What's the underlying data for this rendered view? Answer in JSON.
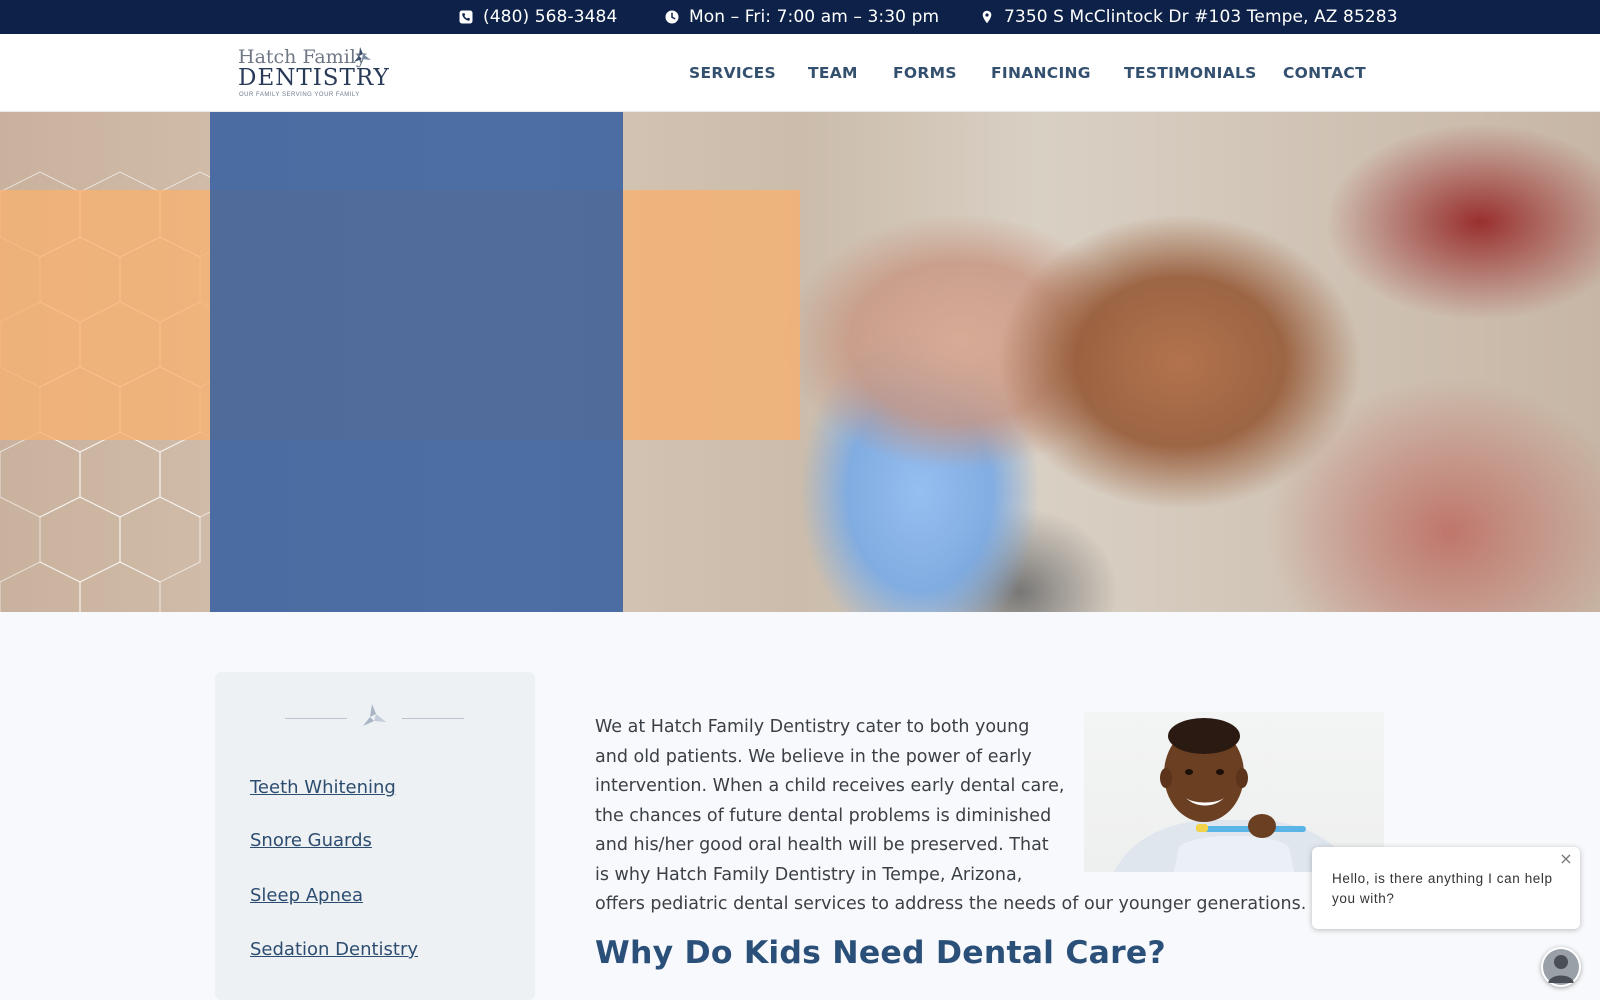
{
  "topbar": {
    "phone": "(480) 568-3484",
    "hours": "Mon – Fri: 7:00 am – 3:30 pm",
    "address": "7350 S McClintock Dr #103 Tempe, AZ 85283",
    "icons": [
      "phone-icon",
      "clock-icon",
      "map-pin-icon"
    ]
  },
  "logo": {
    "line1": "Hatch Family",
    "line2": "DENTISTRY",
    "tagline": "OUR FAMILY SERVING YOUR FAMILY"
  },
  "nav": {
    "items": [
      "SERVICES",
      "TEAM",
      "FORMS",
      "FINANCING",
      "TESTIMONIALS",
      "CONTACT"
    ]
  },
  "sidebar": {
    "links": [
      "Teeth Whitening",
      "Snore Guards",
      "Sleep Apnea",
      "Sedation Dentistry"
    ]
  },
  "content": {
    "paragraph_lines": [
      "We at Hatch Family Dentistry cater to both young",
      "and old patients. We believe in the power of early",
      "intervention. When a child receives early dental care,",
      "the chances of future dental problems is diminished",
      "and his/her good oral health will be preserved. That",
      "is why Hatch Family Dentistry in Tempe, Arizona,",
      "offers pediatric dental services to address the needs of our younger generations."
    ],
    "heading": "Why Do Kids Need Dental Care?"
  },
  "chat": {
    "message": "Hello, is there anything I can help you with?",
    "close_label": "×"
  },
  "colors": {
    "topbar_bg": "#0e2249",
    "nav_text": "#34506f",
    "heading": "#2a4f78",
    "overlay_blue": "#2d5aa0",
    "overlay_orange": "#f7b170"
  }
}
